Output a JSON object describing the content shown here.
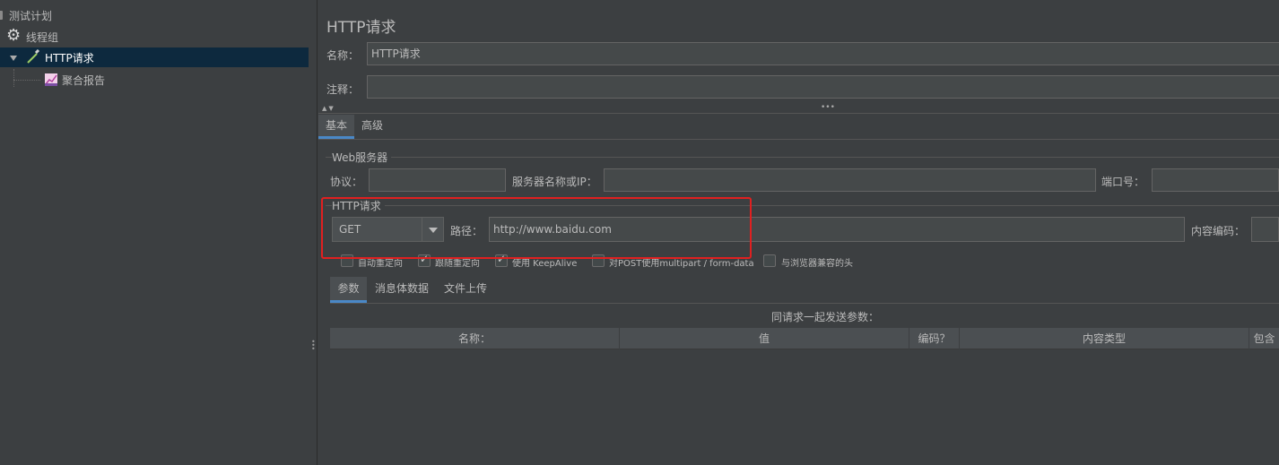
{
  "tree": {
    "items": [
      {
        "label": "测试计划",
        "icon": "test-plan-icon"
      },
      {
        "label": "线程组",
        "icon": "gear-icon"
      },
      {
        "label": "HTTP请求",
        "icon": "pipette-icon",
        "selected": true
      },
      {
        "label": "聚合报告",
        "icon": "chart-icon"
      }
    ]
  },
  "panel": {
    "title": "HTTP请求",
    "name_label": "名称：",
    "name_value": "HTTP请求",
    "comment_label": "注释：",
    "comment_value": "",
    "tabs": [
      {
        "label": "基本",
        "active": true
      },
      {
        "label": "高级",
        "active": false
      }
    ],
    "web_server": {
      "group_title": "Web服务器",
      "protocol_label": "协议：",
      "protocol_value": "",
      "server_label": "服务器名称或IP：",
      "server_value": "",
      "port_label": "端口号：",
      "port_value": ""
    },
    "http_request": {
      "group_title": "HTTP请求",
      "method": "GET",
      "path_label": "路径：",
      "path_value": "http://www.baidu.com",
      "encoding_label": "内容编码：",
      "encoding_value": ""
    },
    "options": [
      {
        "label": "自动重定向",
        "checked": false
      },
      {
        "label": "跟随重定向",
        "checked": true
      },
      {
        "label": "使用 KeepAlive",
        "checked": true
      },
      {
        "label": "对POST使用multipart / form-data",
        "checked": false
      },
      {
        "label": "与浏览器兼容的头",
        "checked": false
      }
    ],
    "sub_tabs": [
      {
        "label": "参数",
        "active": true
      },
      {
        "label": "消息体数据",
        "active": false
      },
      {
        "label": "文件上传",
        "active": false
      }
    ],
    "params_caption": "同请求一起发送参数：",
    "table_headers": [
      "名称：",
      "值",
      "编码？",
      "内容类型",
      "包含"
    ]
  },
  "colors": {
    "background": "#3c3f41",
    "selection": "#0d293e",
    "accent": "#4a88c7",
    "highlight_box": "#e02020"
  }
}
